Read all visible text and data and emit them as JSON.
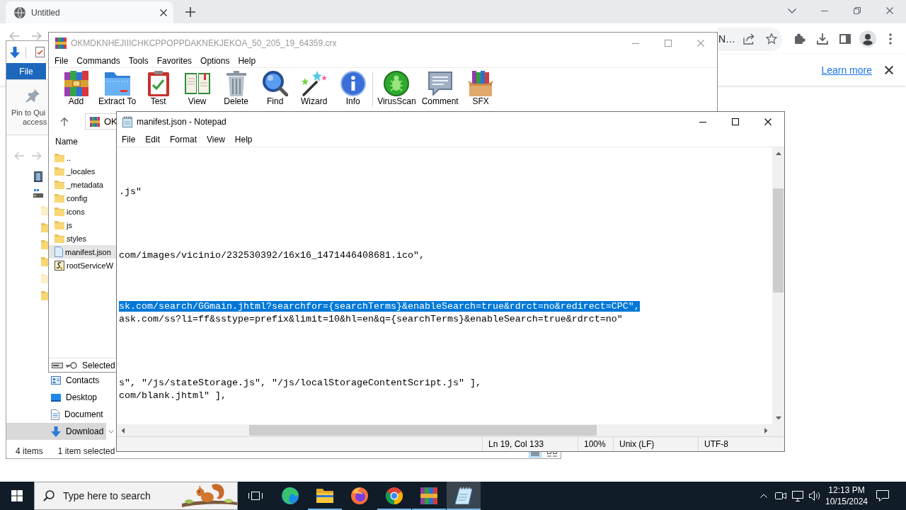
{
  "browser": {
    "tab": {
      "title": "Untitled"
    },
    "address_text": "N…",
    "infobar": {
      "link": "Learn more"
    }
  },
  "explorer": {
    "ribbon_tab": "File",
    "pin_label": [
      "Pin to Qui",
      "access"
    ],
    "nav_items": [
      {
        "kind": "contacts",
        "label": "Contacts",
        "selected": false
      },
      {
        "kind": "desktop",
        "label": "Desktop",
        "selected": false
      },
      {
        "kind": "documents",
        "label": "Document",
        "selected": false
      },
      {
        "kind": "downloads",
        "label": "Download",
        "selected": true
      }
    ],
    "status": {
      "count": "4 items",
      "selection": "1 item selected"
    }
  },
  "archiver": {
    "title": "OKMDKNHEJIIICHKCPPOPPDAKNEKJEKOA_50_205_19_64359.crx",
    "menu": [
      "File",
      "Commands",
      "Tools",
      "Favorites",
      "Options",
      "Help"
    ],
    "toolbar_groups": [
      {
        "buttons": [
          {
            "kind": "add",
            "label": "Add"
          },
          {
            "kind": "extract",
            "label": "Extract To"
          },
          {
            "kind": "test",
            "label": "Test"
          },
          {
            "kind": "view",
            "label": "View"
          },
          {
            "kind": "delete",
            "label": "Delete"
          },
          {
            "kind": "find",
            "label": "Find"
          },
          {
            "kind": "wizard",
            "label": "Wizard"
          },
          {
            "kind": "info",
            "label": "Info"
          }
        ]
      },
      {
        "buttons": [
          {
            "kind": "virusscan",
            "label": "VirusScan"
          },
          {
            "kind": "comment",
            "label": "Comment"
          },
          {
            "kind": "sfx",
            "label": "SFX"
          }
        ]
      }
    ],
    "path": "OK",
    "column": "Name",
    "files": [
      {
        "kind": "parent",
        "name": "..",
        "selected": false
      },
      {
        "kind": "folder",
        "name": "_locales",
        "selected": false
      },
      {
        "kind": "folder",
        "name": "_metadata",
        "selected": false
      },
      {
        "kind": "folder",
        "name": "config",
        "selected": false
      },
      {
        "kind": "folder",
        "name": "icons",
        "selected": false
      },
      {
        "kind": "folder",
        "name": "js",
        "selected": false
      },
      {
        "kind": "folder",
        "name": "styles",
        "selected": false
      },
      {
        "kind": "document",
        "name": "manifest.json",
        "selected": true
      },
      {
        "kind": "script",
        "name": "rootServiceW",
        "selected": false
      }
    ],
    "status": "Selected"
  },
  "notepad": {
    "title": "manifest.json - Notepad",
    "menu": [
      "File",
      "Edit",
      "Format",
      "View",
      "Help"
    ],
    "lines": [
      {
        "kind": "blank"
      },
      {
        "kind": "blank"
      },
      {
        "kind": "blank"
      },
      {
        "kind": "text",
        "text": ".js\"",
        "selected": false
      },
      {
        "kind": "blank"
      },
      {
        "kind": "blank"
      },
      {
        "kind": "blank"
      },
      {
        "kind": "blank"
      },
      {
        "kind": "text",
        "text": "com/images/vicinio/232530392/16x16_1471446408681.ico\",",
        "selected": false
      },
      {
        "kind": "blank"
      },
      {
        "kind": "blank"
      },
      {
        "kind": "blank"
      },
      {
        "kind": "text",
        "text": "sk.com/search/GGmain.jhtml?searchfor={searchTerms}&enableSearch=true&rdrct=no&redirect=CPC\",",
        "selected": true
      },
      {
        "kind": "text",
        "text": "ask.com/ss?li=ff&sstype=prefix&limit=10&hl=en&q={searchTerms}&enableSearch=true&rdrct=no\"",
        "selected": false
      },
      {
        "kind": "blank"
      },
      {
        "kind": "blank"
      },
      {
        "kind": "blank"
      },
      {
        "kind": "blank"
      },
      {
        "kind": "text",
        "text": "s\", \"/js/stateStorage.js\", \"/js/localStorageContentScript.js\" ],",
        "selected": false
      },
      {
        "kind": "text",
        "text": "com/blank.jhtml\" ],",
        "selected": false
      },
      {
        "kind": "blank"
      }
    ],
    "status": {
      "position": "Ln 19, Col 133",
      "zoom": "100%",
      "line_ending": "Unix (LF)",
      "encoding": "UTF-8"
    }
  },
  "taskbar": {
    "search_placeholder": "Type here to search",
    "apps": [
      {
        "kind": "edge",
        "running": false,
        "selected": false
      },
      {
        "kind": "explorer",
        "running": true,
        "selected": false
      },
      {
        "kind": "firefox",
        "running": false,
        "selected": false
      },
      {
        "kind": "chrome",
        "running": true,
        "selected": false
      },
      {
        "kind": "winrar",
        "running": true,
        "selected": false
      },
      {
        "kind": "notepad",
        "running": true,
        "selected": true
      }
    ],
    "time": "12:13 PM",
    "date": "10/15/2024"
  }
}
